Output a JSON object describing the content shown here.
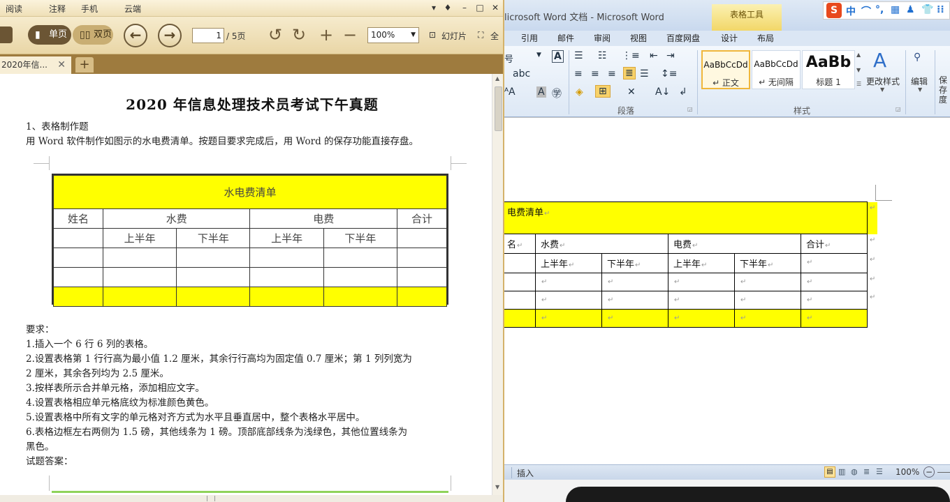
{
  "reader": {
    "menu": [
      "阅读",
      "注释",
      "手机",
      "云端"
    ],
    "window_controls": [
      "▾",
      "♦",
      "–",
      "□",
      "✕"
    ],
    "toolbar": {
      "single_page": "单页",
      "double_page": "双页",
      "page_current": "1",
      "page_total": "/ 5页",
      "zoom": "100%",
      "slideshow": "幻灯片",
      "fullscreen": "全"
    },
    "tab": {
      "title": "2020年信...",
      "close": "✕",
      "new": "+"
    },
    "page": {
      "title": "2020 年信息处理技术员考试下午真题",
      "section": "1、表格制作题",
      "intro": "用 Word 软件制作如图示的水电费清单。按题目要求完成后，用 Word 的保存功能直接存盘。",
      "figure": {
        "title": "水电费清单",
        "col_name": "姓名",
        "col_water": "水费",
        "col_elec": "电费",
        "col_total": "合计",
        "h1": "上半年",
        "h2": "下半年"
      },
      "req_heading": "要求：",
      "requirements": [
        "1.插入一个 6 行 6 列的表格。",
        "2.设置表格第 1 行行高为最小值 1.2 厘米，其余行行高均为固定值 0.7 厘米；第 1 列列宽为",
        "2 厘米，其余各列均为 2.5 厘米。",
        "3.按样表所示合并单元格，添加相应文字。",
        "4.设置表格相应单元格底纹为标准颜色黄色。",
        "5.设置表格中所有文字的单元格对齐方式为水平且垂直居中，整个表格水平居中。",
        "6.表格边框左右两侧为 1.5 磅，其他线条为 1 磅。顶部底部线条为浅绿色，其他位置线条为",
        "黑色。"
      ],
      "answer_heading": "试题答案："
    }
  },
  "word": {
    "title": "licrosoft Word 文档  -  Microsoft Word",
    "table_tools": "表格工具",
    "ime": [
      "S",
      "中",
      "⌒",
      "°,",
      "▦",
      "♟",
      "👕",
      "⁞⁞"
    ],
    "tabs": [
      "引用",
      "邮件",
      "审阅",
      "视图",
      "百度网盘",
      "设计",
      "布局"
    ],
    "ribbon": {
      "font_partial": "号",
      "paragraph_label": "段落",
      "styles_label": "样式",
      "styles": [
        {
          "sample": "AaBbCcDd",
          "name": "↵ 正文"
        },
        {
          "sample": "AaBbCcDd",
          "name": "↵ 无间隔"
        },
        {
          "sample": "AaBb",
          "name": "标题 1"
        }
      ],
      "change_styles": "更改样式",
      "edit": "编辑",
      "edit_partial": "保存度"
    },
    "table": {
      "title": "电费清单",
      "name_partial": "名",
      "water": "水费",
      "elec": "电费",
      "total": "合计",
      "h1": "上半年",
      "h2": "下半年",
      "mark": "↵"
    },
    "status": {
      "insert": "插入",
      "zoom": "100%"
    }
  }
}
